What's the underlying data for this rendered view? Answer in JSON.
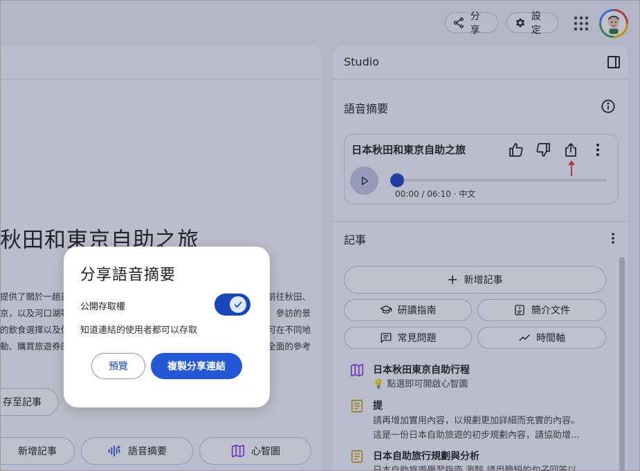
{
  "topbar": {
    "share_label": "分享",
    "settings_label": "設定"
  },
  "left": {
    "doc_title": "本秋田和東京自助之旅",
    "lines": [
      {
        "left": "提供了關於一趟日",
        "right": "前往秋田、"
      },
      {
        "left": "京，以及河口湖等",
        "right": "參訪的景"
      },
      {
        "left": "的飲食選擇以及住",
        "right": "可在不同地"
      },
      {
        "left": "動、購買旅遊券的",
        "right": "全面的參考"
      }
    ],
    "save_note": "存至記事",
    "actions": {
      "add_note": "新增記事",
      "audio_summary": "語音摘要",
      "mind_map": "心智圖"
    }
  },
  "studio": {
    "title": "Studio",
    "audio_section": "語音摘要",
    "audio_card": {
      "title": "日本秋田和東京自助之旅",
      "time": "00:00 / 06:10 · 中文",
      "progress": 0
    },
    "notes_section": "記事",
    "add_note": "新增記事",
    "chips": {
      "study_guide": "研讀指南",
      "brief_doc": "簡介文件",
      "faq": "常見問題",
      "timeline": "時間軸"
    },
    "notes": [
      {
        "title": "日本秋田東京自助行程",
        "lines": [
          "💡 點選即可開啟心智圖"
        ]
      },
      {
        "title": "提",
        "lines": [
          "請再增加實用內容，以規劃更加詳細而充實的內容。",
          "這是一份日本自助旅遊的初步規劃內容，請協助增..."
        ]
      },
      {
        "title": "日本自助旅行規劃與分析",
        "lines": [
          "日本自助旅遊學習指南 測驗 請用簡短的句子回答以"
        ]
      }
    ]
  },
  "dialog": {
    "title": "分享語音摘要",
    "public_access_label": "公開存取權",
    "public_access_on": true,
    "description": "知道連結的使用者都可以存取",
    "preview_label": "預覽",
    "copy_link_label": "複製分享連結"
  },
  "colors": {
    "primary": "#2457d4",
    "overlay": "#282d5a",
    "note_mindmap": "#9334e6",
    "note_doc": "#d49a00",
    "accent_arrow": "#ea4335"
  }
}
